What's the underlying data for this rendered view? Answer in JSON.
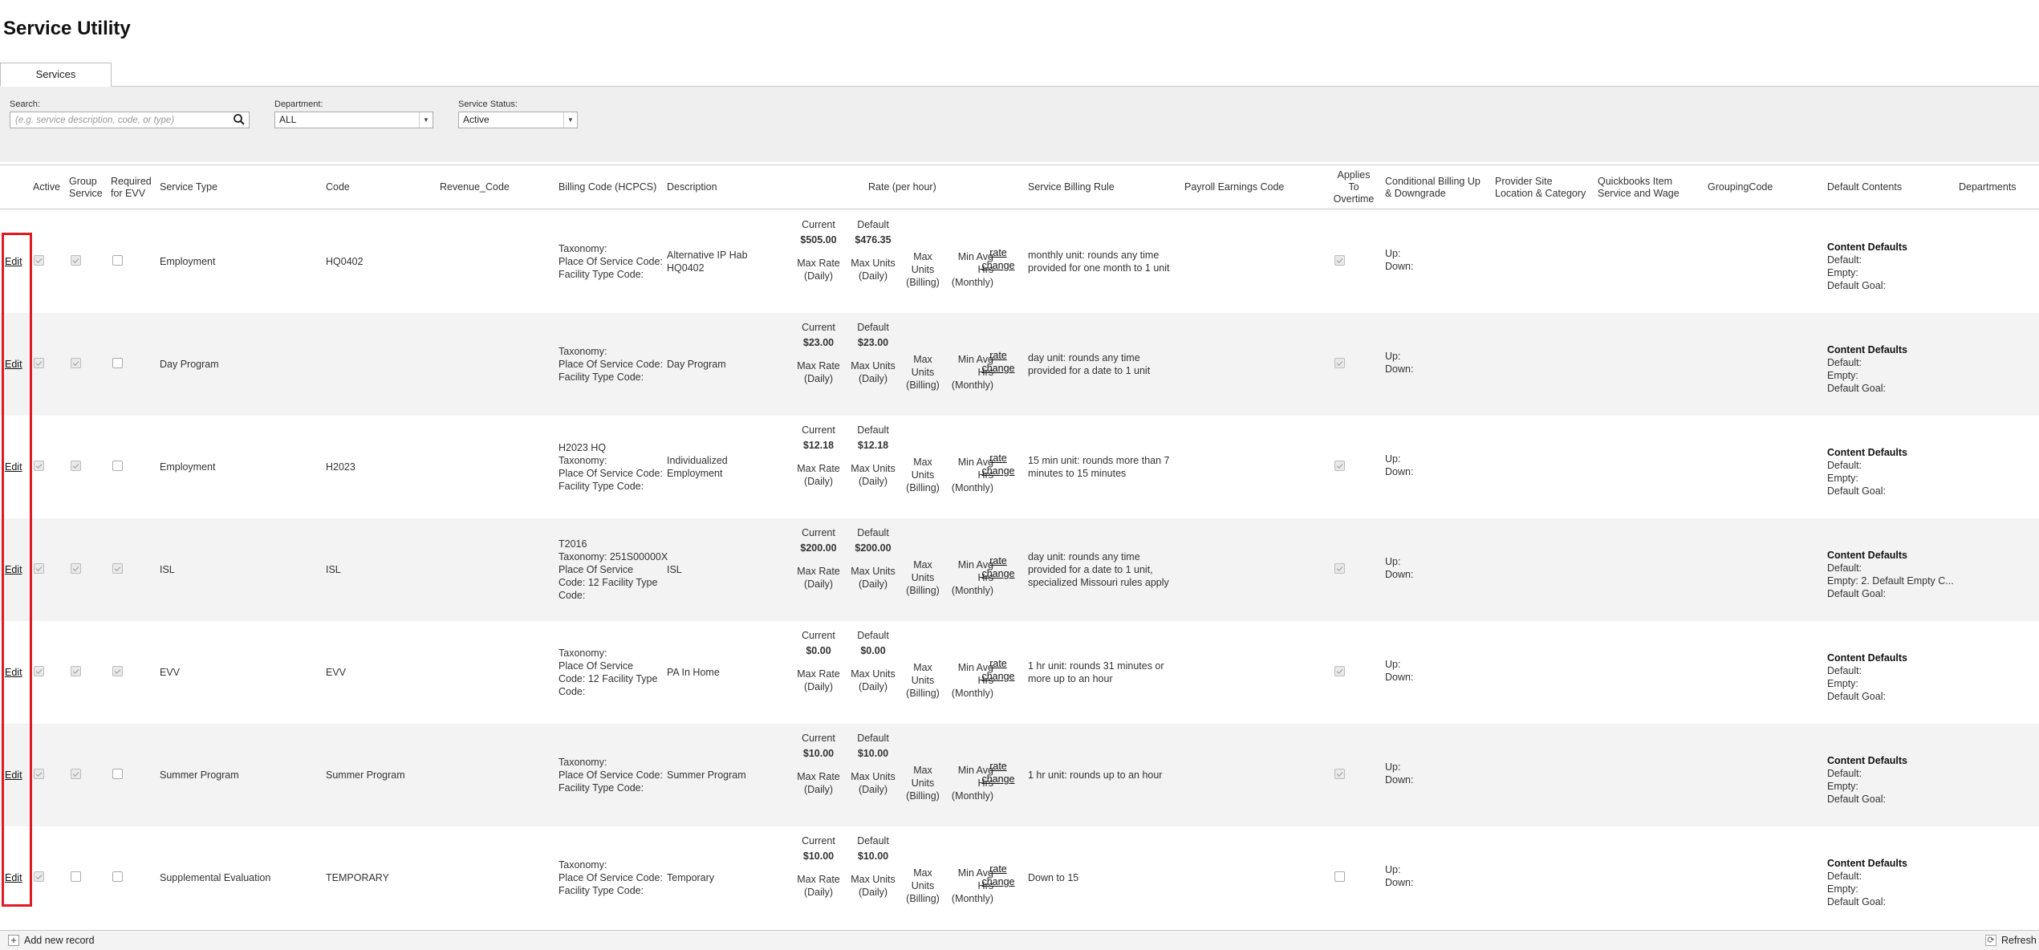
{
  "page": {
    "title": "Service Utility"
  },
  "tabs": [
    {
      "label": "Services"
    }
  ],
  "filters": {
    "search": {
      "label": "Search:",
      "placeholder": "(e.g. service description, code, or type)"
    },
    "department": {
      "label": "Department:",
      "value": "ALL"
    },
    "status": {
      "label": "Service Status:",
      "value": "Active"
    }
  },
  "columns": {
    "active": "Active",
    "group": [
      "Group",
      "Service"
    ],
    "evv": [
      "Required",
      "for EVV"
    ],
    "type": "Service Type",
    "code": "Code",
    "revenue": "Revenue_Code",
    "billing": "Billing Code (HCPCS)",
    "description": "Description",
    "rate": "Rate (per hour)",
    "rule": "Service Billing Rule",
    "payroll": "Payroll Earnings Code",
    "overtime": [
      "Applies",
      "To",
      "Overtime"
    ],
    "conditional": [
      "Conditional Billing Up",
      "& Downgrade"
    ],
    "provider": [
      "Provider Site",
      "Location & Category"
    ],
    "quickbooks": [
      "Quickbooks Item",
      "Service and Wage"
    ],
    "grouping": "GroupingCode",
    "defaults": "Default Contents",
    "departments": "Departments"
  },
  "rate_labels": {
    "current": "Current",
    "default": "Default",
    "max_rate": [
      "Max Rate",
      "(Daily)"
    ],
    "max_units_daily": [
      "Max Units",
      "(Daily)"
    ],
    "max_units_billing": [
      "Max",
      "Units",
      "(Billing)"
    ],
    "min_avg": [
      "Min Avg",
      "Hrs",
      "(Monthly)"
    ],
    "rate_change": [
      "rate",
      "change"
    ]
  },
  "row_labels": {
    "edit": "Edit",
    "up": "Up:",
    "down": "Down:",
    "cd_title": "Content Defaults",
    "cd_default": "Default:",
    "cd_empty": "Empty:",
    "cd_goal": "Default Goal:"
  },
  "rows": [
    {
      "active": true,
      "group": true,
      "evv": false,
      "overtime": true,
      "type": "Employment",
      "code": "HQ0402",
      "billing": [
        "Taxonomy:",
        "Place Of Service Code:",
        "Facility Type Code:"
      ],
      "description": [
        "Alternative IP Hab",
        "HQ0402"
      ],
      "current": "$505.00",
      "default": "$476.35",
      "rule": [
        "monthly unit: rounds any time",
        "provided for one month to 1 unit"
      ],
      "cd_empty": ""
    },
    {
      "active": true,
      "group": true,
      "evv": false,
      "overtime": true,
      "type": "Day Program",
      "code": "",
      "billing": [
        "Taxonomy:",
        "Place Of Service Code:",
        "Facility Type Code:"
      ],
      "description": [
        "Day Program"
      ],
      "current": "$23.00",
      "default": "$23.00",
      "rule": [
        "day unit: rounds any time",
        "provided for a date to 1 unit"
      ],
      "cd_empty": ""
    },
    {
      "active": true,
      "group": true,
      "evv": false,
      "overtime": true,
      "type": "Employment",
      "code": "H2023",
      "billing": [
        "H2023 HQ",
        "Taxonomy:",
        "Place Of Service Code:",
        "Facility Type Code:"
      ],
      "description": [
        "Individualized",
        "Employment"
      ],
      "current": "$12.18",
      "default": "$12.18",
      "rule": [
        "15 min unit: rounds more than 7",
        "minutes to 15 minutes"
      ],
      "cd_empty": ""
    },
    {
      "active": true,
      "group": true,
      "evv": true,
      "overtime": true,
      "type": "ISL",
      "code": "ISL",
      "billing": [
        "T2016",
        "Taxonomy: 251S00000X",
        "Place Of Service",
        "Code: 12 Facility Type",
        "Code:"
      ],
      "description": [
        "ISL"
      ],
      "current": "$200.00",
      "default": "$200.00",
      "rule": [
        "day unit: rounds any time",
        "provided for a date to 1 unit,",
        "specialized Missouri rules apply"
      ],
      "cd_empty": "2. Default Empty C..."
    },
    {
      "active": true,
      "group": true,
      "evv": true,
      "overtime": true,
      "type": "EVV",
      "code": "EVV",
      "billing": [
        "Taxonomy:",
        "Place Of Service",
        "Code: 12 Facility Type",
        "Code:"
      ],
      "description": [
        "PA In Home"
      ],
      "current": "$0.00",
      "default": "$0.00",
      "rule": [
        "1 hr unit: rounds 31 minutes or",
        "more up to an hour"
      ],
      "cd_empty": ""
    },
    {
      "active": true,
      "group": true,
      "evv": false,
      "overtime": true,
      "type": "Summer Program",
      "code": "Summer Program",
      "billing": [
        "Taxonomy:",
        "Place Of Service Code:",
        "Facility Type Code:"
      ],
      "description": [
        "Summer Program"
      ],
      "current": "$10.00",
      "default": "$10.00",
      "rule": [
        "1 hr unit: rounds up to an hour"
      ],
      "cd_empty": ""
    },
    {
      "active": true,
      "group": false,
      "evv": false,
      "overtime": false,
      "type": "Supplemental Evaluation",
      "code": "TEMPORARY",
      "billing": [
        "Taxonomy:",
        "Place Of Service Code:",
        "Facility Type Code:"
      ],
      "description": [
        "Temporary"
      ],
      "current": "$10.00",
      "default": "$10.00",
      "rule": [
        "Down to 15"
      ],
      "cd_empty": ""
    }
  ],
  "footer": {
    "add_label": "Add new record",
    "refresh_label": "Refresh"
  },
  "colors": {
    "highlight": "#e01b24",
    "row_alt": "#f3f3f3",
    "filter_bg": "#efefef"
  }
}
